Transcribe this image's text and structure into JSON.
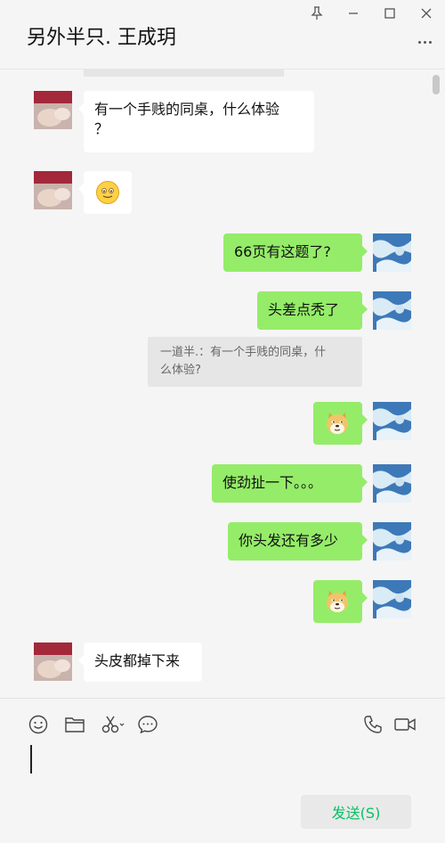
{
  "window": {
    "title": "另外半只. 王成玥"
  },
  "messages": [
    {
      "side": "in",
      "text": "有一个手贱的同桌，什么体验",
      "text2": "？"
    },
    {
      "side": "in",
      "emoji": "smile"
    },
    {
      "side": "out",
      "text": "66页有这题了?"
    },
    {
      "side": "out",
      "text": "头差点秃了"
    },
    {
      "side": "quote",
      "text": "一道半.：有一个手贱的同桌，什么体验?"
    },
    {
      "side": "out",
      "emoji": "doge"
    },
    {
      "side": "out",
      "text": "使劲扯一下。。。"
    },
    {
      "side": "out",
      "text": "你头发还有多少"
    },
    {
      "side": "out",
      "emoji": "doge"
    },
    {
      "side": "in",
      "text": "头皮都掉下来"
    }
  ],
  "quote": {
    "line1": "一道半.：有一个手贱的同桌，什",
    "line2": "么体验?"
  },
  "input": {
    "send_label": "发送(S)"
  },
  "colors": {
    "background": "#f5f5f5",
    "bubble_out": "#95ec69",
    "bubble_in": "#ffffff",
    "send_text": "#07c160"
  }
}
